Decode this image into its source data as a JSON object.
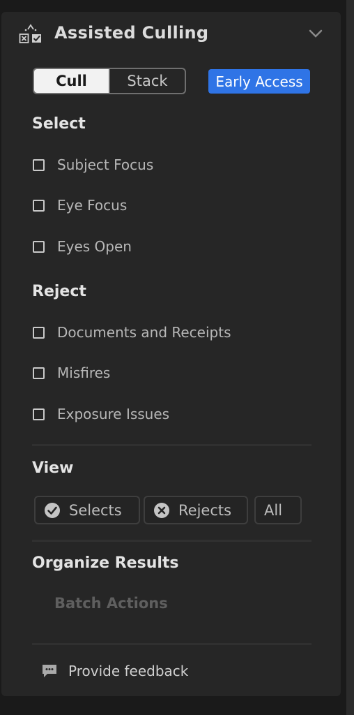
{
  "panel": {
    "title": "Assisted Culling",
    "icon": "assisted-culling-icon",
    "collapse_icon": "chevron-down-icon"
  },
  "mode_toggle": {
    "options": [
      "Cull",
      "Stack"
    ],
    "selected": "Cull"
  },
  "badge": {
    "label": "Early Access",
    "color": "#2f74e6"
  },
  "select_section": {
    "title": "Select",
    "options": [
      {
        "label": "Subject Focus",
        "checked": false
      },
      {
        "label": "Eye Focus",
        "checked": false
      },
      {
        "label": "Eyes Open",
        "checked": false
      }
    ]
  },
  "reject_section": {
    "title": "Reject",
    "options": [
      {
        "label": "Documents and Receipts",
        "checked": false
      },
      {
        "label": "Misfires",
        "checked": false
      },
      {
        "label": "Exposure Issues",
        "checked": false
      }
    ]
  },
  "view_section": {
    "title": "View",
    "buttons": [
      {
        "label": "Selects",
        "icon": "check-circle-icon"
      },
      {
        "label": "Rejects",
        "icon": "x-circle-icon"
      },
      {
        "label": "All"
      }
    ]
  },
  "organize_section": {
    "title": "Organize Results",
    "batch_actions_label": "Batch Actions"
  },
  "feedback": {
    "label": "Provide feedback",
    "icon": "comment-icon"
  }
}
